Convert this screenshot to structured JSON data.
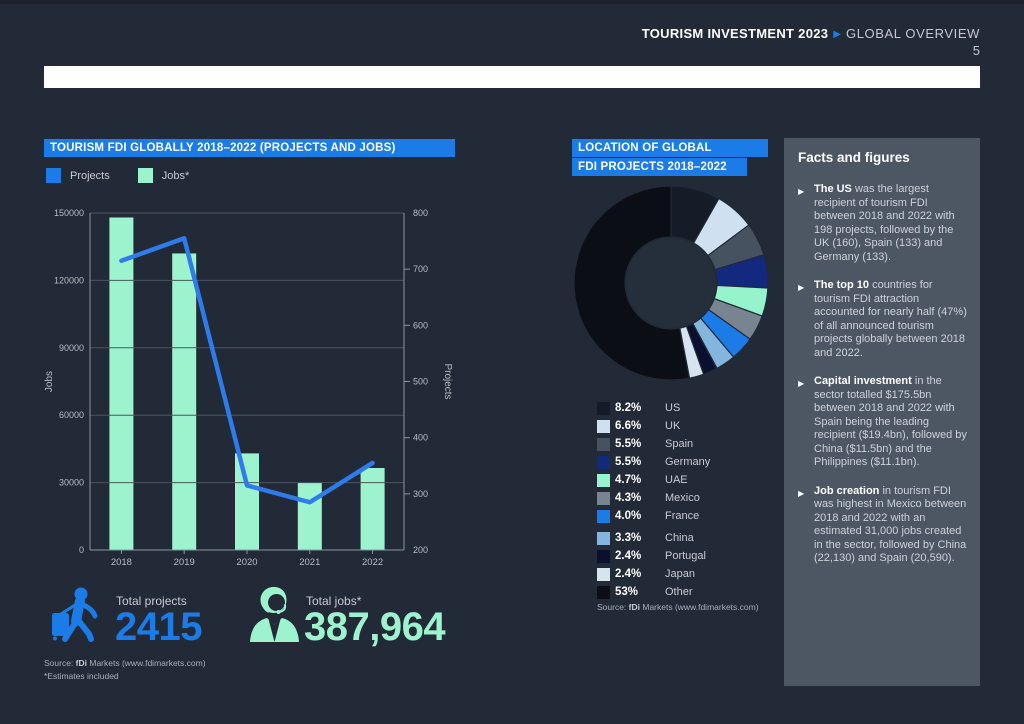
{
  "header": {
    "brand": "TOURISM INVESTMENT 2023",
    "arrow": "▶",
    "section": "GLOBAL OVERVIEW",
    "page_number": "5"
  },
  "colors": {
    "background": "#212a36",
    "accent_blue": "#1b7ce8",
    "mint": "#9df3cd",
    "line_blue": "#2f7bea",
    "panel_gray": "#4d5764",
    "grid": "#4a5560",
    "axis": "#8b95a1",
    "tick_text": "#b6bdc6",
    "donut_hole": "#252e3b"
  },
  "chart_data": [
    {
      "type": "bar",
      "title": "TOURISM FDI GLOBALLY 2018–2022 (PROJECTS AND JOBS)",
      "categories": [
        "2018",
        "2019",
        "2020",
        "2021",
        "2022"
      ],
      "series": [
        {
          "name": "Jobs*",
          "type": "bar",
          "axis": "left",
          "color": "#9df3cd",
          "values": [
            148000,
            132000,
            43000,
            30000,
            36500
          ]
        },
        {
          "name": "Projects",
          "type": "line",
          "axis": "right",
          "color": "#2f7bea",
          "values": [
            715,
            755,
            315,
            285,
            355
          ]
        }
      ],
      "y_left": {
        "label": "Jobs",
        "min": 0,
        "max": 150000,
        "ticks": [
          0,
          30000,
          60000,
          90000,
          120000,
          150000
        ]
      },
      "y_right": {
        "label": "Projects",
        "min": 200,
        "max": 800,
        "ticks": [
          200,
          300,
          400,
          500,
          600,
          700,
          800
        ]
      },
      "grid": true,
      "legend_position": "top",
      "legend": [
        {
          "label": "Projects",
          "color": "#1b7ce8"
        },
        {
          "label": "Jobs*",
          "color": "#9df3cd"
        }
      ]
    },
    {
      "type": "pie",
      "donut": true,
      "title": [
        "LOCATION OF GLOBAL",
        "FDI PROJECTS 2018–2022"
      ],
      "slices": [
        {
          "label": "US",
          "pct": 8.2,
          "pct_label": "8.2%",
          "color": "#151c27"
        },
        {
          "label": "UK",
          "pct": 6.6,
          "pct_label": "6.6%",
          "color": "#cfe1f0"
        },
        {
          "label": "Spain",
          "pct": 5.5,
          "pct_label": "5.5%",
          "color": "#46525f"
        },
        {
          "label": "Germany",
          "pct": 5.5,
          "pct_label": "5.5%",
          "color": "#12297e"
        },
        {
          "label": "UAE",
          "pct": 4.7,
          "pct_label": "4.7%",
          "color": "#96f4cd"
        },
        {
          "label": "Mexico",
          "pct": 4.3,
          "pct_label": "4.3%",
          "color": "#78848f"
        },
        {
          "label": "France",
          "pct": 4.0,
          "pct_label": "4.0%",
          "color": "#1b7ce8"
        },
        {
          "label": "China",
          "pct": 3.3,
          "pct_label": "3.3%",
          "color": "#84b6dd"
        },
        {
          "label": "Portugal",
          "pct": 2.4,
          "pct_label": "2.4%",
          "color": "#0a102e"
        },
        {
          "label": "Japan",
          "pct": 2.4,
          "pct_label": "2.4%",
          "color": "#d6e4f0"
        },
        {
          "label": "Other",
          "pct": 53,
          "pct_label": "53%",
          "color": "#0b0f15"
        }
      ],
      "legend_gap_before": "China"
    }
  ],
  "totals": {
    "projects": {
      "label": "Total projects",
      "value": "2415"
    },
    "jobs": {
      "label": "Total jobs*",
      "value": "387,964"
    }
  },
  "sources": {
    "prefix": "Source: ",
    "brand": "fDi",
    "rest": " Markets (www.fdimarkets.com)",
    "estimates": "*Estimates included"
  },
  "facts": {
    "title": "Facts and figures",
    "bullets": [
      {
        "bold": "The US",
        "rest": " was the largest recipient of tourism FDI between 2018 and 2022 with 198 projects, followed by the UK (160), Spain (133) and Germany (133)."
      },
      {
        "bold": "The top 10",
        "rest": " countries for tourism FDI attraction accounted for nearly half (47%) of all announced tourism projects globally between 2018 and 2022."
      },
      {
        "bold": "Capital investment",
        "rest": " in the sector totalled $175.5bn between 2018 and 2022 with Spain being the leading recipient ($19.4bn), followed by China ($11.5bn) and the Philippines ($11.1bn)."
      },
      {
        "bold": "Job creation",
        "rest": " in tourism FDI was highest in Mexico between 2018 and 2022 with an estimated 31,000 jobs created in the sector, followed by China (22,130) and Spain (20,590)."
      }
    ]
  }
}
